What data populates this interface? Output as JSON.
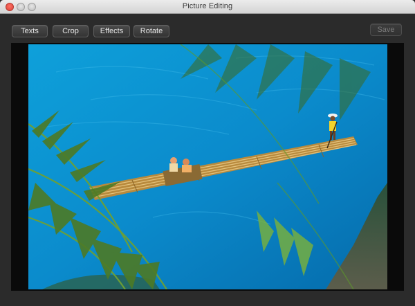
{
  "window": {
    "title": "Picture Editing"
  },
  "toolbar": {
    "texts_label": "Texts",
    "crop_label": "Crop",
    "effects_label": "Effects",
    "rotate_label": "Rotate",
    "save_label": "Save"
  },
  "image": {
    "subject": "bamboo raft on turquoise river with palm fronds",
    "colors": {
      "water": "#0a8fd0",
      "water_dark": "#0566a8",
      "raft": "#c9a35a",
      "frond": "#5c8a2a"
    }
  }
}
